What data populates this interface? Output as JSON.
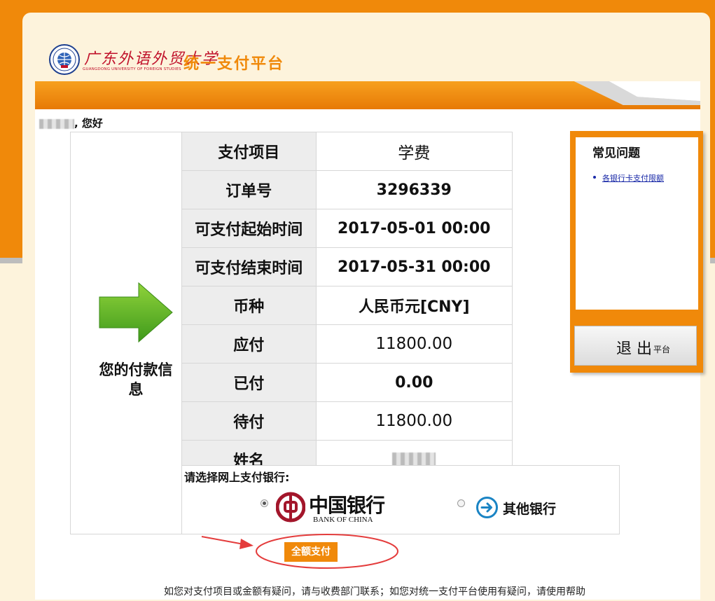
{
  "header": {
    "logo_text": "广东外语外贸大学",
    "logo_subtext": "GUANGDONG UNIVERSITY OF FOREIGN STUDIES",
    "platform_title": "统一支付平台"
  },
  "greeting": {
    "suffix": ", 您好"
  },
  "payment": {
    "left_label": "您的付款信息",
    "rows": [
      {
        "key": "支付项目",
        "value": "学费"
      },
      {
        "key": "订单号",
        "value": "3296339"
      },
      {
        "key": "可支付起始时间",
        "value": "2017-05-01 00:00"
      },
      {
        "key": "可支付结束时间",
        "value": "2017-05-31 00:00"
      },
      {
        "key": "币种",
        "value": "人民币元[CNY]"
      },
      {
        "key": "应付",
        "value": "11800.00"
      },
      {
        "key": "已付",
        "value": "0.00"
      },
      {
        "key": "待付",
        "value": "11800.00"
      },
      {
        "key": "姓名",
        "value": ""
      }
    ]
  },
  "bank_select": {
    "prompt": "请选择网上支付银行:",
    "options": [
      {
        "name_cn": "中国银行",
        "name_en": "BANK OF CHINA",
        "selected": true
      },
      {
        "name_cn": "其他银行",
        "selected": false
      }
    ]
  },
  "pay_button": {
    "label": "全额支付"
  },
  "footer": {
    "text": "如您对支付项目或金额有疑问，请与收费部门联系；如您对统一支付平台使用有疑问，请使用帮助"
  },
  "faq": {
    "title": "常见问题",
    "links": [
      "各银行卡支付限额"
    ]
  },
  "logout": {
    "label": "退 出",
    "sub": "平台"
  },
  "colors": {
    "brand_orange": "#f0890a",
    "annotation_red": "#e43c3c",
    "link_blue": "#1a2aa8"
  }
}
